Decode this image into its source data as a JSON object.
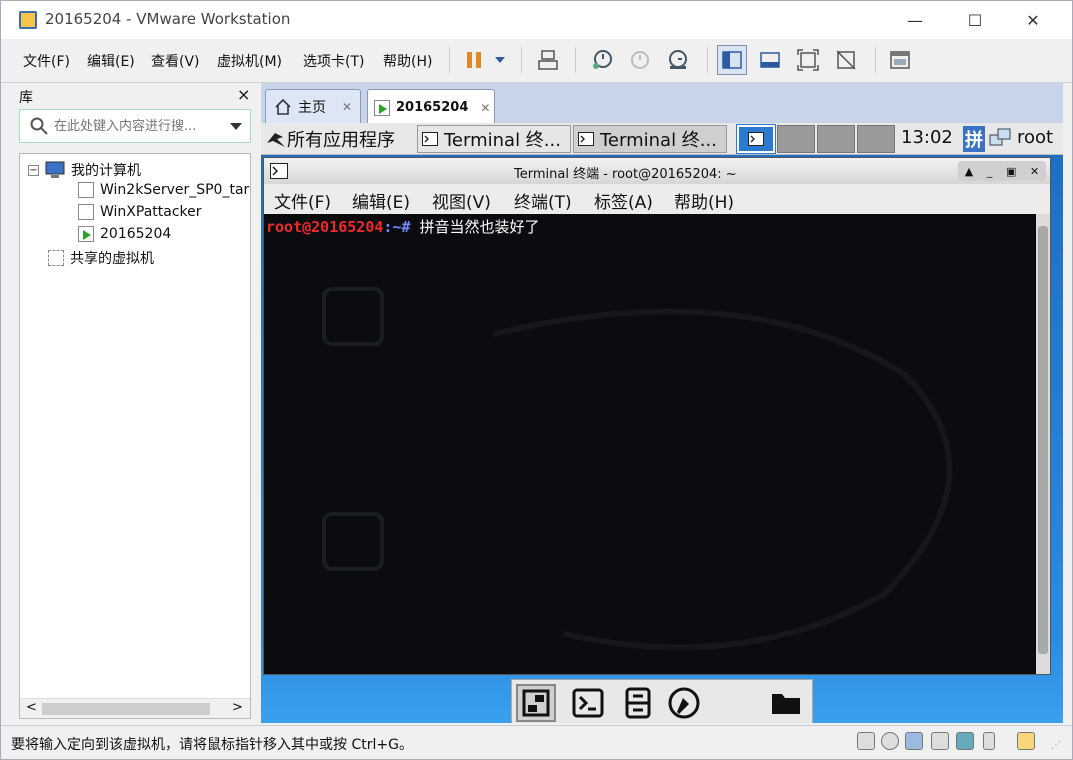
{
  "window": {
    "title": "20165204 - VMware Workstation",
    "controls": {
      "minimize": "—",
      "maximize": "☐",
      "close": "✕"
    }
  },
  "menubar": {
    "items": [
      "文件(F)",
      "编辑(E)",
      "查看(V)",
      "虚拟机(M)",
      "选项卡(T)",
      "帮助(H)"
    ]
  },
  "library": {
    "title": "库",
    "close": "×",
    "search_placeholder": "在此处键入内容进行搜...",
    "tree": {
      "root": "我的计算机",
      "vms": [
        "Win2kServer_SP0_tar",
        "WinXPattacker",
        "20165204"
      ],
      "shared": "共享的虚拟机"
    },
    "scroll_left": "<",
    "scroll_right": ">"
  },
  "tabs": [
    {
      "label": "主页",
      "close": "✕"
    },
    {
      "label": "20165204",
      "close": "✕"
    }
  ],
  "guest_panel": {
    "apps_label": "所有应用程序",
    "tasks": [
      "Terminal 终...",
      "Terminal 终..."
    ],
    "clock": "13:02",
    "ime": "拼",
    "user": "root"
  },
  "terminal": {
    "title": "Terminal 终端 - root@20165204: ~",
    "menu": [
      "文件(F)",
      "编辑(E)",
      "视图(V)",
      "终端(T)",
      "标签(A)",
      "帮助(H)"
    ],
    "prompt_user": "root@20165204",
    "prompt_path": ":~#",
    "command": " 拼音当然也装好了"
  },
  "statusbar": {
    "text": "要将输入定向到该虚拟机，请将鼠标指针移入其中或按 Ctrl+G。"
  },
  "colors": {
    "prompt_user": "#ef2929",
    "prompt_path": "#6f8cff",
    "pause": "#e08a1e",
    "desktop": "#2a7bd0"
  }
}
